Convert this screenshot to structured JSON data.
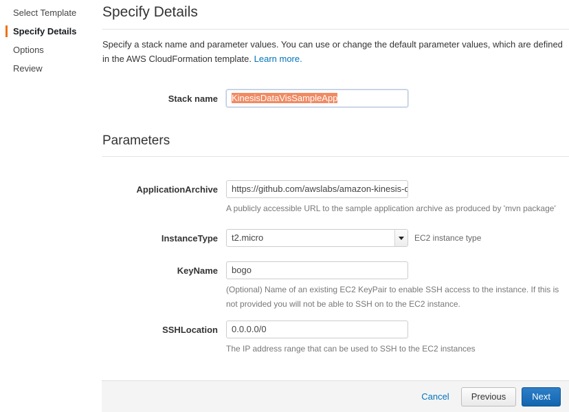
{
  "sidebar": {
    "items": [
      {
        "label": "Select Template",
        "active": false
      },
      {
        "label": "Specify Details",
        "active": true
      },
      {
        "label": "Options",
        "active": false
      },
      {
        "label": "Review",
        "active": false
      }
    ]
  },
  "header": {
    "title": "Specify Details",
    "intro_text": "Specify a stack name and parameter values. You can use or change the default parameter values, which are defined in the AWS CloudFormation template. ",
    "learn_more_label": "Learn more."
  },
  "stack_name": {
    "label": "Stack name",
    "value": "KinesisDataVisSampleApp",
    "selected": true
  },
  "parameters_section": {
    "title": "Parameters"
  },
  "parameters": [
    {
      "label": "ApplicationArchive",
      "type": "text",
      "value": "https://github.com/awslabs/amazon-kinesis-data",
      "help": "A publicly accessible URL to the sample application archive as produced by 'mvn package'",
      "side_note": ""
    },
    {
      "label": "InstanceType",
      "type": "select",
      "value": "t2.micro",
      "help": "",
      "side_note": "EC2 instance type"
    },
    {
      "label": "KeyName",
      "type": "text",
      "value": "bogo",
      "help": "(Optional) Name of an existing EC2 KeyPair to enable SSH access to the instance. If this is not provided you will not be able to SSH on to the EC2 instance.",
      "side_note": ""
    },
    {
      "label": "SSHLocation",
      "type": "text",
      "value": "0.0.0.0/0",
      "help": "The IP address range that can be used to SSH to the EC2 instances",
      "side_note": ""
    }
  ],
  "footer": {
    "cancel_label": "Cancel",
    "previous_label": "Previous",
    "next_label": "Next"
  },
  "colors": {
    "accent_orange": "#ec7211",
    "link_blue": "#0073bb",
    "primary_button_blue": "#1164ad",
    "selection_highlight": "#f08a63"
  }
}
